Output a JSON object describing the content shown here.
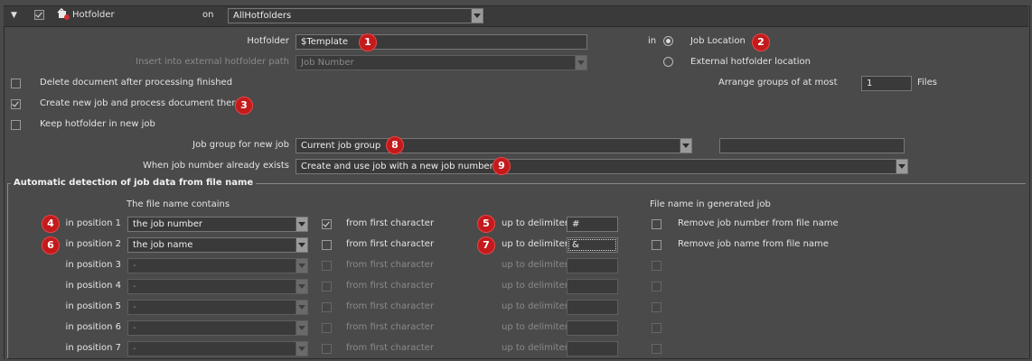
{
  "header": {
    "hotfolder_label": "Hotfolder",
    "on_label": "on",
    "scope_value": "AllHotfolders"
  },
  "hotfolder": {
    "label": "Hotfolder",
    "value": "$Template",
    "in_label": "in",
    "job_location_label": "Job Location",
    "external_location_label": "External hotfolder location",
    "insert_path_label": "Insert into external hotfolder path",
    "insert_path_value": "Job Number"
  },
  "options": {
    "delete_doc_label": "Delete document after processing finished",
    "create_job_label": "Create new job and process document there",
    "keep_hotfolder_label": "Keep hotfolder in new job",
    "arrange_groups_label": "Arrange groups of at most",
    "arrange_groups_value": "1",
    "files_label": "Files"
  },
  "job_group": {
    "label": "Job group for new job",
    "value": "Current job group",
    "text_value": ""
  },
  "job_exists": {
    "label": "When job number already exists",
    "value": "Create and use job with a new job number"
  },
  "auto_detect": {
    "title": "Automatic detection of job data from file name",
    "contains_header": "The file name contains",
    "generated_header": "File name in generated job",
    "rows": [
      {
        "position": "in position 1",
        "value": "the job number",
        "from_first": "from first character",
        "delimiter_label": "up to delimiter",
        "delimiter": "#",
        "remove_label": "Remove job number from file name"
      },
      {
        "position": "in position 2",
        "value": "the job name",
        "from_first": "from first character",
        "delimiter_label": "up to delimiter",
        "delimiter": "&",
        "remove_label": "Remove job name from file name"
      },
      {
        "position": "in position 3",
        "value": "-",
        "from_first": "from first character",
        "delimiter_label": "up to delimiter",
        "delimiter": "",
        "remove_label": ""
      },
      {
        "position": "in position 4",
        "value": "-",
        "from_first": "from first character",
        "delimiter_label": "up to delimiter",
        "delimiter": "",
        "remove_label": ""
      },
      {
        "position": "in position 5",
        "value": "-",
        "from_first": "from first character",
        "delimiter_label": "up to delimiter",
        "delimiter": "",
        "remove_label": ""
      },
      {
        "position": "in position 6",
        "value": "-",
        "from_first": "from first character",
        "delimiter_label": "up to delimiter",
        "delimiter": "",
        "remove_label": ""
      },
      {
        "position": "in position 7",
        "value": "-",
        "from_first": "from first character",
        "delimiter_label": "up to delimiter",
        "delimiter": "",
        "remove_label": ""
      }
    ]
  },
  "badges": [
    "1",
    "2",
    "3",
    "4",
    "5",
    "6",
    "7",
    "8",
    "9"
  ],
  "colors": {
    "background": "#4a4a4a",
    "badge": "#c41a1c",
    "input_bg": "#3a3a3a"
  }
}
